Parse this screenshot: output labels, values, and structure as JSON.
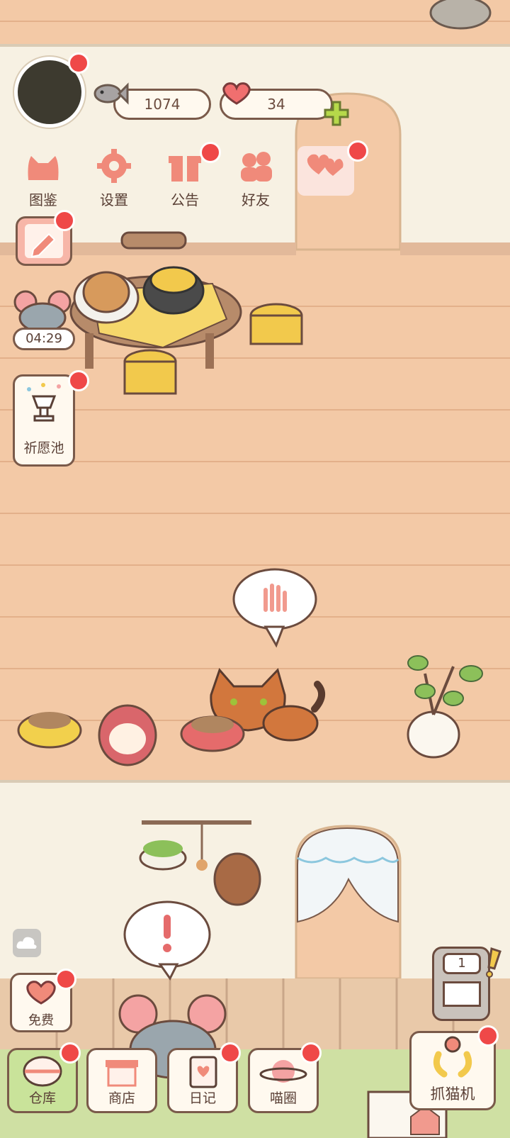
{
  "currency": {
    "fish_count": "1074",
    "heart_count": "34"
  },
  "top_menu": [
    {
      "label": "图鉴",
      "icon": "cat-face-icon"
    },
    {
      "label": "设置",
      "icon": "gear-icon"
    },
    {
      "label": "公告",
      "icon": "gift-icon"
    },
    {
      "label": "好友",
      "icon": "friends-icon"
    },
    {
      "label": "",
      "icon": "hearts-icon"
    }
  ],
  "timer": "04:29",
  "wishing_pool_label": "祈愿池",
  "free_label": "免费",
  "bottom_bar": [
    {
      "label": "仓库"
    },
    {
      "label": "商店"
    },
    {
      "label": "日记"
    },
    {
      "label": "喵圈"
    }
  ],
  "claw_machine": {
    "label": "抓猫机",
    "counter": "1"
  },
  "colors": {
    "accent_red": "#ef4848",
    "wall_cream": "#f7f1e3",
    "floor_peach": "#f3c9a6",
    "outline": "#7a5a4a"
  }
}
